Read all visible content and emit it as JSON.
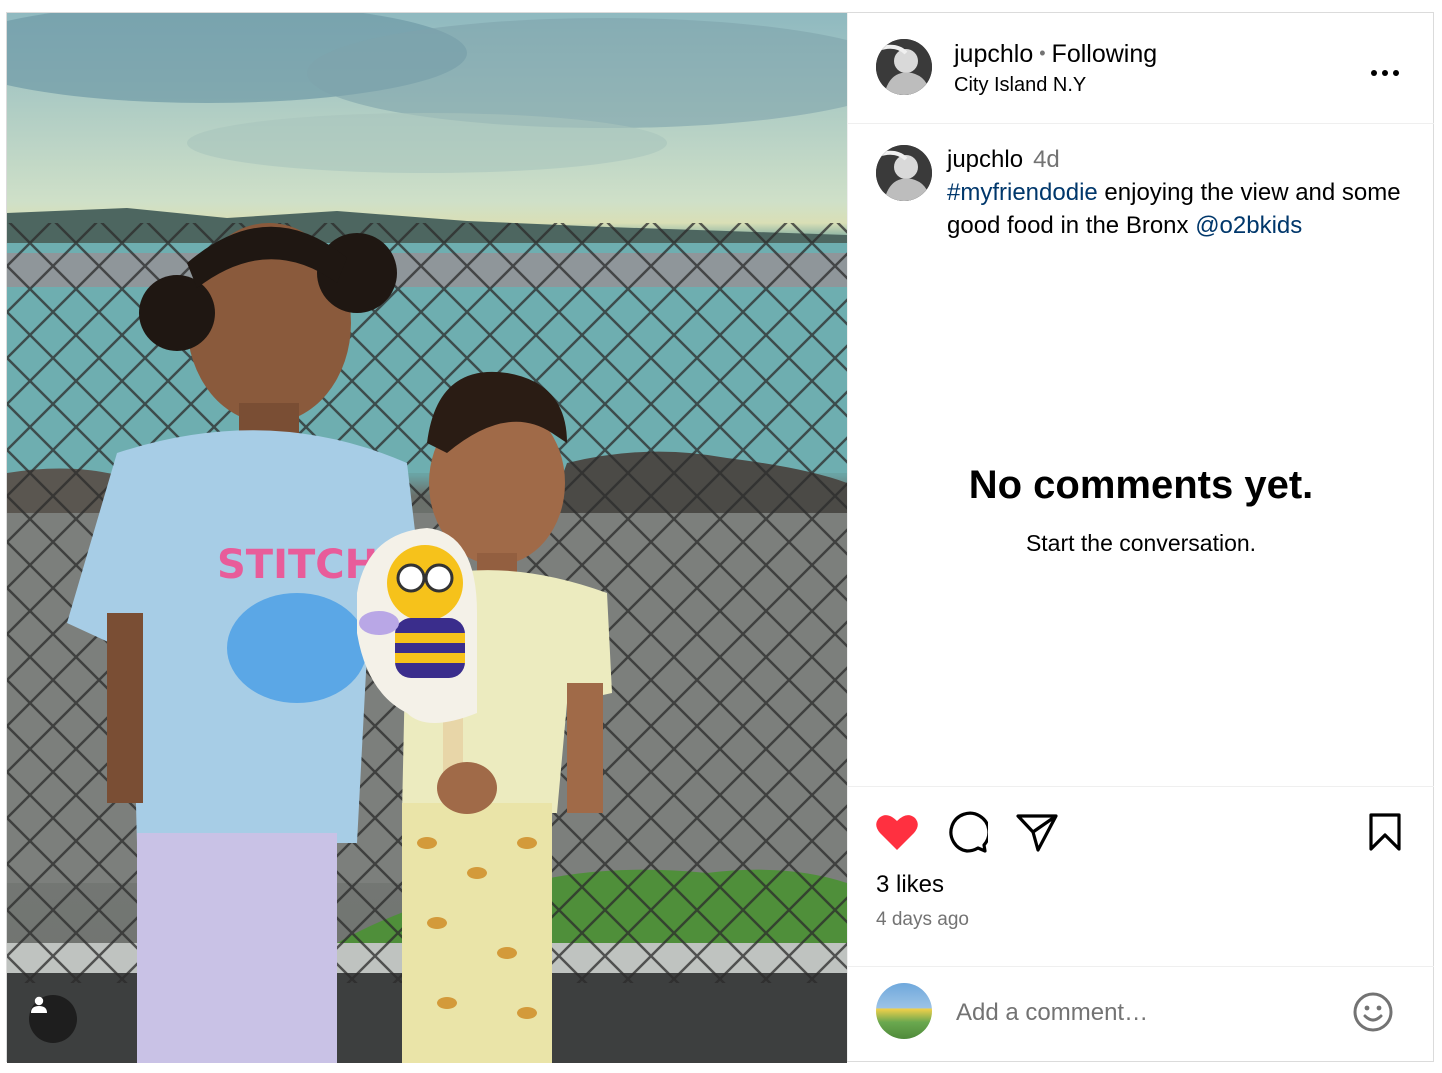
{
  "post": {
    "username": "jupchlo",
    "follow_status": "Following",
    "location": "City Island N.Y",
    "caption": {
      "username": "jupchlo",
      "time": "4d",
      "hashtag": "#myfriendodie",
      "text_mid": " enjoying the view and some good food in the Bronx ",
      "mention": "@o2bkids"
    },
    "empty_comments": {
      "title": "No comments yet.",
      "subtitle": "Start the conversation."
    },
    "likes_text": "3 likes",
    "timestamp": "4 days ago",
    "comment_placeholder": "Add a comment…",
    "liked": true
  },
  "icons": {
    "more": "more-options-icon",
    "like": "heart-icon",
    "comment": "comment-icon",
    "share": "share-icon",
    "save": "bookmark-icon",
    "emoji": "emoji-icon",
    "user_tag": "user-tag-icon"
  },
  "colors": {
    "like_red": "#ff3040",
    "link_blue": "#00376b",
    "secondary_text": "#737373",
    "divider": "#dbdbdb"
  }
}
